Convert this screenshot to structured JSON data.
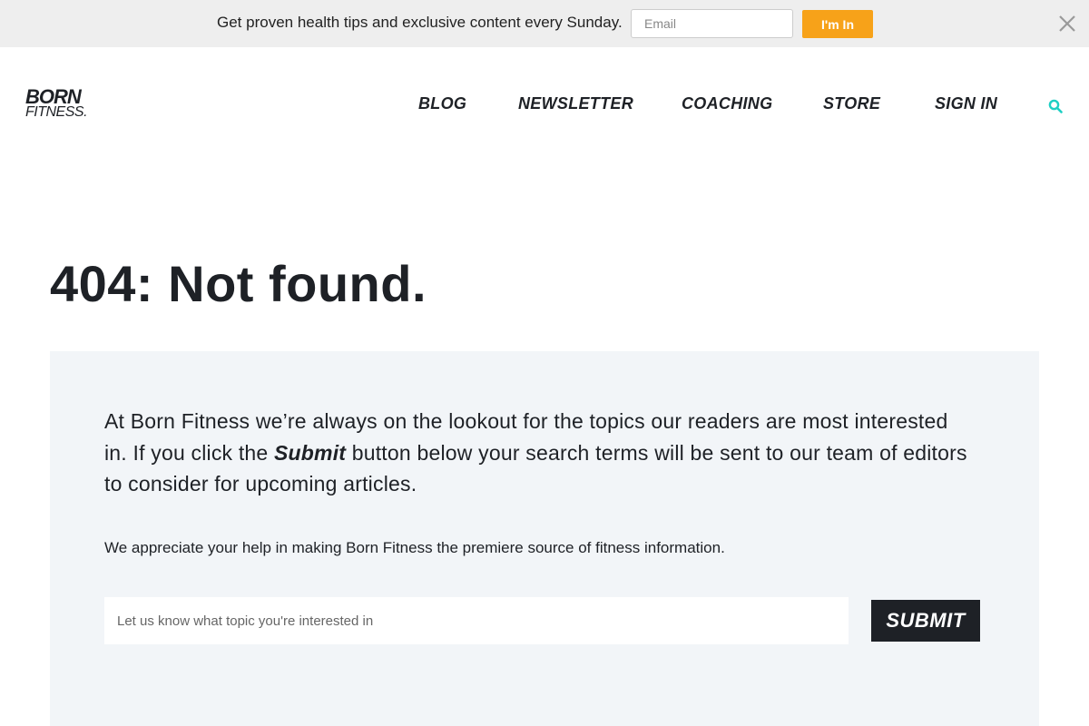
{
  "topbar": {
    "message": "Get proven health tips and exclusive content every Sunday.",
    "email_placeholder": "Email",
    "button_label": "I'm In",
    "close_icon": "close-icon"
  },
  "logo": {
    "line1": "BORN",
    "line2": "FITNESS."
  },
  "nav": {
    "items": [
      "BLOG",
      "NEWSLETTER",
      "COACHING",
      "STORE",
      "SIGN IN"
    ],
    "search_icon": "search-icon",
    "search_color": "#1ecfc4"
  },
  "main": {
    "title": "404: Not found.",
    "intro_before": "At Born Fitness we’re always on the lookout for the topics our readers are most interested in. If you click the ",
    "intro_emphasis": "Submit",
    "intro_after": " button below your search terms will be sent to our team of editors to consider for upcoming articles.",
    "appreciate": "We appreciate your help in making Born Fitness the premiere source of fitness information.",
    "topic_placeholder": "Let us know what topic you're interested in",
    "submit_label": "SUBMIT"
  },
  "colors": {
    "accent": "#f7a219",
    "dark": "#1e2126",
    "panel": "#f2f5f8",
    "search": "#1ecfc4"
  }
}
